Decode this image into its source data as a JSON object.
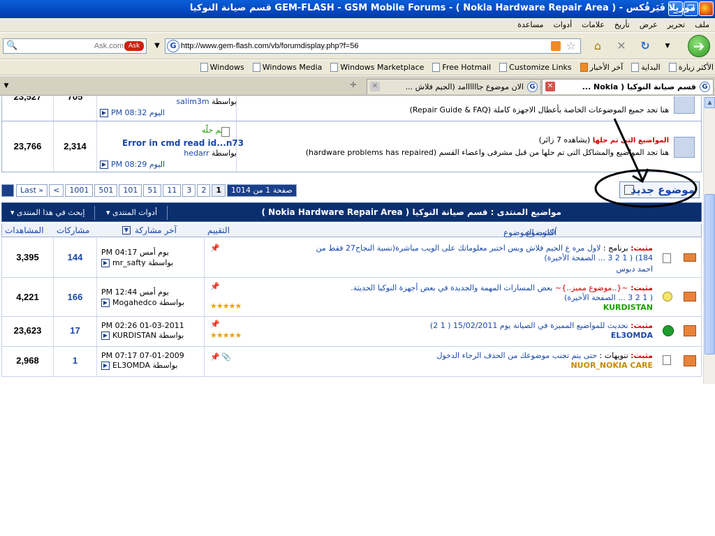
{
  "window": {
    "title": "موزيلا فَيَرفُكس - GEM-FLASH - GSM Mobile Forums - ( Nokia Hardware Repair Area ) قسم صيانة النوكيا"
  },
  "menu": [
    "ملف",
    "تحرير",
    "عرض",
    "تأريخ",
    "علامات",
    "أدوات",
    "مساعدة"
  ],
  "nav": {
    "search_placeholder": "Ask.com",
    "url": "http://www.gem-flash.com/vb/forumdisplay.php?f=56"
  },
  "bookmarks": [
    "الأكثر زيارة",
    "البداية",
    "آخر الأخبار",
    "Customize Links",
    "Free Hotmail",
    "Windows Marketplace",
    "Windows Media",
    "Windows"
  ],
  "tabs": [
    {
      "label": "قسم صيانة النوكيا ( Nokia ...",
      "active": true
    },
    {
      "label": "الان موضوع جاااااامد (الجيم فلاش ...",
      "active": false
    }
  ],
  "forum": {
    "top_row": {
      "views": "23,527",
      "replies": "705",
      "author": "salim3m",
      "by": "بواسطة",
      "time": "اليوم 08:32 PM",
      "desc": "هنا تجد جميع الموضوعات الخاصة بأعطال الاجهزة كاملة (Repair Guide & FAQ)"
    },
    "sub_row": {
      "views": "23,766",
      "replies": "2,314",
      "status": "تم حلّه",
      "last_title": "Error in cmd read id...n73",
      "author": "hedarr",
      "by": "بواسطة",
      "time": "اليوم 08:29 PM",
      "name": "المواضيع التى تم حلها",
      "viewers": "(يشاهده 7 زائر)",
      "desc_line1": "هنا تجد المواضيع والمشاكل التى تم حلها من قبل مشرفى واعضاء القسم (hardware problems has repaired)"
    },
    "pager": {
      "info": "صفحة 1 من 1014",
      "pages": [
        "1",
        "2",
        "3",
        "11",
        "51",
        "101",
        "501",
        "1001"
      ],
      "prev": "<",
      "last": "Last »"
    },
    "new_topic": "موضوع جديد",
    "bar": {
      "title": "مواضيع المنتدى : قسم صيانة النوكيا ( Nokia Hardware Repair Area )",
      "tools": "أدوات المنتدى",
      "search": "إبحث في هذا المنتدى"
    },
    "columns": {
      "topic": "الموضوع",
      "starter": "كاتب الموضوع",
      "rating": "التقييم",
      "last_post": "آخر مشاركة",
      "replies": "مشاركات",
      "views": "المشاهدات"
    },
    "threads": [
      {
        "prefix": "مثبت:",
        "tag": "برنامج :",
        "title": "لاول مره ع الجيم فلاش وبس اختبر معلوماتك على الويب مباشرة(نسبة النجاح27 فقط من",
        "title2": "184)",
        "pages": "( 1 2 3 ... الصفحة الأخيرة)",
        "author": "احمد دبوس",
        "last_time": "يوم أمس 04:17 PM",
        "last_by": "بواسطة mr_safty",
        "replies": "144",
        "views": "3,395",
        "stars": ""
      },
      {
        "prefix": "مثبت:",
        "tag": "~{..موضوع مميز..}~",
        "title": "بعض المسارات المهمة والجديدة في بعض أجهزة النوكيا الحديثة.",
        "title2": "",
        "pages": "( 1 2 3 ... الصفحة الأخيرة)",
        "author": "KURDISTAN",
        "last_time": "يوم أمس 12:44 PM",
        "last_by": "بواسطة Mogahedco",
        "replies": "166",
        "views": "4,221",
        "stars": "★★★★★"
      },
      {
        "prefix": "مثبت:",
        "tag": "",
        "title": "تحديث للمواضيع المميزة في الصيانة يوم 15/02/2011",
        "title2": "",
        "pages": "( 1 2)",
        "author": "EL3OMDA",
        "last_time": "01-03-2011 02:26 PM",
        "last_by": "بواسطة KURDISTAN",
        "replies": "17",
        "views": "23,623",
        "stars": "★★★★★"
      },
      {
        "prefix": "مثبت:",
        "tag": "تنويهات :",
        "title": "حتى يتم تجنب موضوعك من الحذف الرجاء الدخول",
        "title2": "",
        "pages": "",
        "author": "NUOR_NOKIA CARE",
        "last_time": "07-01-2009 07:17 PM",
        "last_by": "بواسطة EL3OMDA",
        "replies": "1",
        "views": "2,968",
        "stars": ""
      }
    ]
  },
  "colors": {
    "titlebar": "#0448c0",
    "dark_bar": "#0b2f6e",
    "link": "#1a48a8",
    "sticky": "#d00000",
    "author_green": "#1ca000"
  }
}
